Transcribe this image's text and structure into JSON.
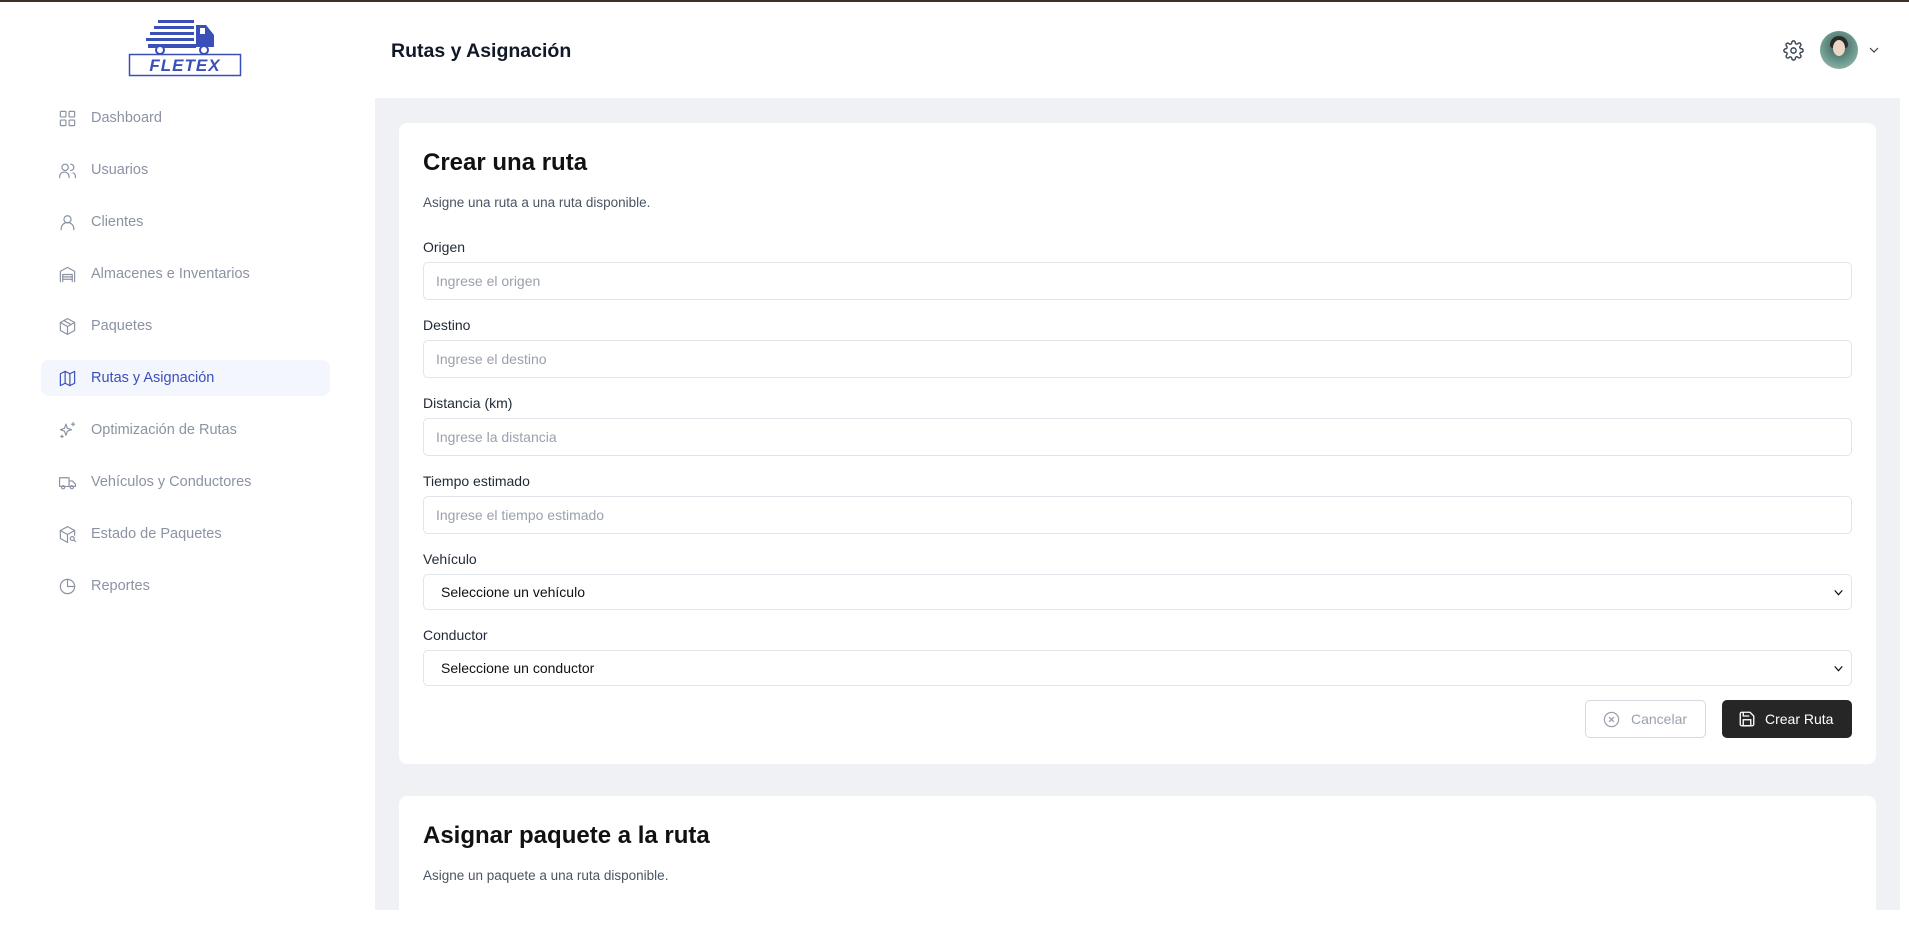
{
  "app": {
    "logo_text": "FLETEX"
  },
  "header": {
    "title": "Rutas y Asignación"
  },
  "sidebar": {
    "items": [
      {
        "label": "Dashboard",
        "icon": "grid-icon"
      },
      {
        "label": "Usuarios",
        "icon": "users-icon"
      },
      {
        "label": "Clientes",
        "icon": "user-icon"
      },
      {
        "label": "Almacenes e Inventarios",
        "icon": "warehouse-icon"
      },
      {
        "label": "Paquetes",
        "icon": "package-icon"
      },
      {
        "label": "Rutas y Asignación",
        "icon": "map-icon",
        "active": true
      },
      {
        "label": "Optimización de Rutas",
        "icon": "sparkles-icon"
      },
      {
        "label": "Vehículos y Conductores",
        "icon": "truck-icon"
      },
      {
        "label": "Estado de Paquetes",
        "icon": "package-search-icon"
      },
      {
        "label": "Reportes",
        "icon": "pie-chart-icon"
      }
    ]
  },
  "create_route": {
    "title": "Crear una ruta",
    "description": "Asigne una ruta a una ruta disponible.",
    "origin": {
      "label": "Origen",
      "placeholder": "Ingrese el origen",
      "value": ""
    },
    "destination": {
      "label": "Destino",
      "placeholder": "Ingrese el destino",
      "value": ""
    },
    "distance": {
      "label": "Distancia (km)",
      "placeholder": "Ingrese la distancia",
      "value": ""
    },
    "time": {
      "label": "Tiempo estimado",
      "placeholder": "Ingrese el tiempo estimado",
      "value": ""
    },
    "vehicle": {
      "label": "Vehículo",
      "selected": "Seleccione un vehículo"
    },
    "driver": {
      "label": "Conductor",
      "selected": "Seleccione un conductor"
    },
    "cancel_label": "Cancelar",
    "submit_label": "Crear Ruta"
  },
  "assign_package": {
    "title": "Asignar paquete a la ruta",
    "description": "Asigne un paquete a una ruta disponible."
  },
  "colors": {
    "accent": "#3b4fb8",
    "active_bg": "#f3f6fd",
    "primary_button": "#262626",
    "main_bg": "#f0f1f5"
  }
}
